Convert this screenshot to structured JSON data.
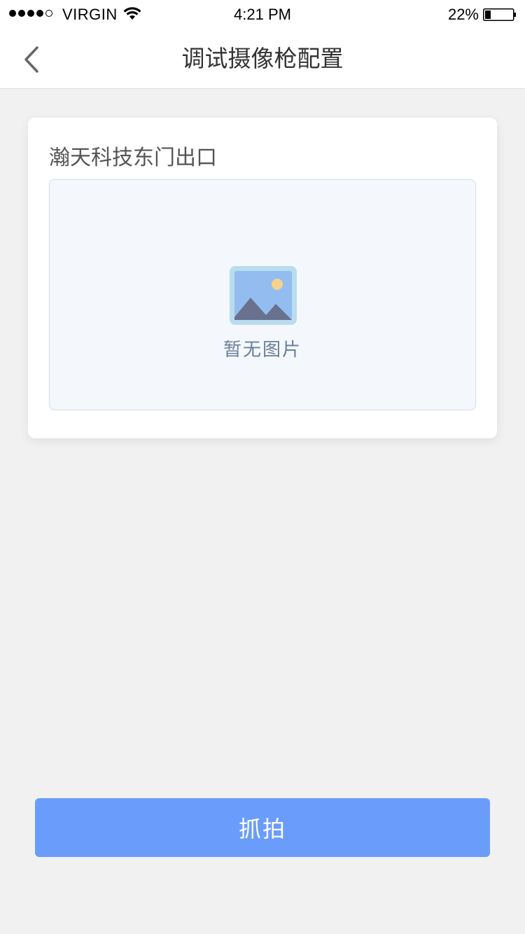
{
  "status_bar": {
    "carrier": "VIRGIN",
    "time": "4:21 PM",
    "battery_percent": "22%",
    "battery_level": 0.22,
    "signal_bars": 4,
    "signal_total": 5
  },
  "nav": {
    "back_icon": "chevron-left-icon",
    "title": "调试摄像枪配置"
  },
  "camera": {
    "name": "瀚天科技东门出口",
    "placeholder_icon": "image-placeholder-icon",
    "placeholder_text": "暂无图片"
  },
  "actions": {
    "capture_label": "抓拍"
  },
  "colors": {
    "primary": "#6a9dfb",
    "background": "#f1f1f1",
    "image_bg": "#f4f8fd",
    "placeholder_text": "#6b7f9a"
  }
}
